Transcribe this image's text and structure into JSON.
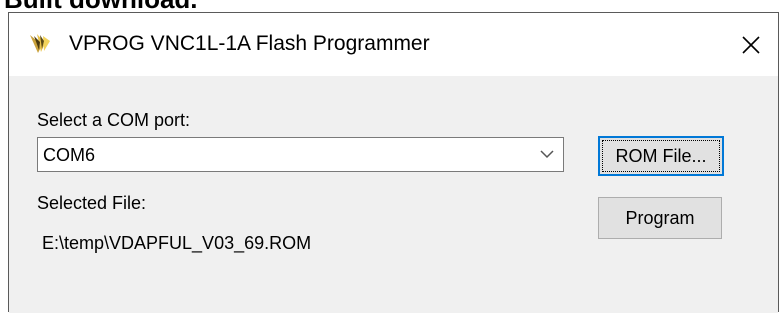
{
  "page_caption": "Built download.",
  "window": {
    "title": "VPROG VNC1L-1A Flash Programmer",
    "icon": "vprog-app-icon",
    "close_icon": "close-icon",
    "close_symbol": "✕"
  },
  "form": {
    "com_port_label": "Select a COM port:",
    "com_port_value": "COM6",
    "selected_file_label": "Selected File:",
    "selected_file_value": "E:\\temp\\VDAPFUL_V03_69.ROM"
  },
  "buttons": {
    "rom_file": "ROM File...",
    "program": "Program"
  },
  "colors": {
    "client_bg": "#f0f0f0",
    "focus_border": "#0078d7",
    "button_bg": "#e1e1e1"
  }
}
